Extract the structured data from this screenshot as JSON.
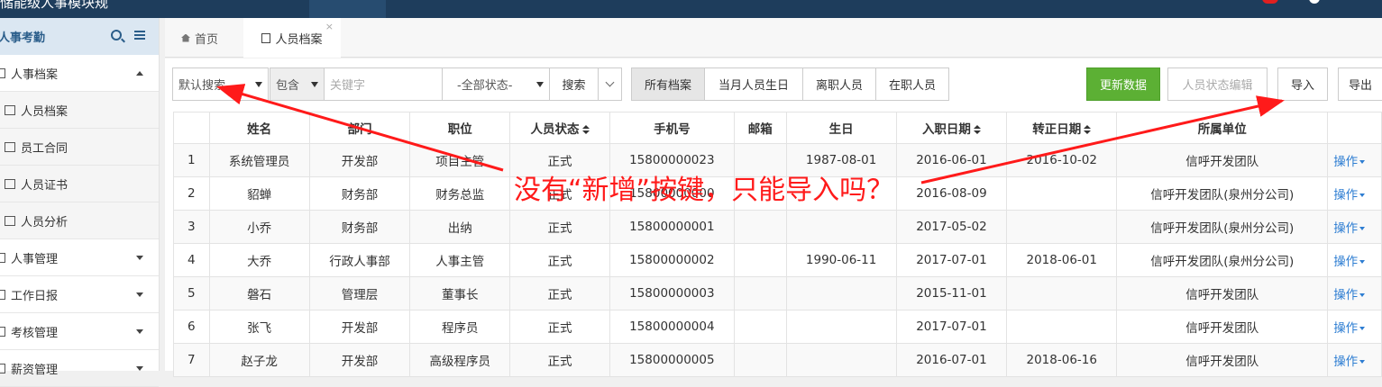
{
  "topbar": {
    "title": "储能级人事模块规",
    "tab_label": ""
  },
  "sidebar": {
    "header": "人事考勤",
    "items": [
      {
        "label": "人事档案",
        "level": "group",
        "expanded": true
      },
      {
        "label": "人员档案",
        "level": "sub"
      },
      {
        "label": "员工合同",
        "level": "sub"
      },
      {
        "label": "人员证书",
        "level": "sub"
      },
      {
        "label": "人员分析",
        "level": "sub"
      },
      {
        "label": "人事管理",
        "level": "group",
        "expanded": false
      },
      {
        "label": "工作日报",
        "level": "group",
        "expanded": false
      },
      {
        "label": "考核管理",
        "level": "group",
        "expanded": false
      },
      {
        "label": "薪资管理",
        "level": "group",
        "expanded": false
      }
    ]
  },
  "tabs": {
    "home": "首页",
    "active": "人员档案",
    "close": "×"
  },
  "toolbar": {
    "search_mode": "默认搜索",
    "match_mode": "包含",
    "keyword_placeholder": "关键字",
    "status_filter": "-全部状态-",
    "search_button": "搜索",
    "segments": [
      "所有档案",
      "当月人员生日",
      "离职人员",
      "在职人员"
    ],
    "refresh_button": "更新数据",
    "status_edit_button": "人员状态编辑",
    "import_button": "导入",
    "export_button": "导出"
  },
  "table": {
    "columns": [
      "",
      "姓名",
      "部门",
      "职位",
      "人员状态",
      "手机号",
      "邮箱",
      "生日",
      "入职日期",
      "转正日期",
      "所属单位",
      ""
    ],
    "rows": [
      [
        "1",
        "系统管理员",
        "开发部",
        "项目主管",
        "正式",
        "15800000023",
        "",
        "1987-08-01",
        "2016-06-01",
        "2016-10-02",
        "信呼开发团队",
        "操作"
      ],
      [
        "2",
        "貂蝉",
        "财务部",
        "财务总监",
        "正式",
        "15800000000",
        "",
        "",
        "2016-08-09",
        "",
        "信呼开发团队(泉州分公司)",
        "操作"
      ],
      [
        "3",
        "小乔",
        "财务部",
        "出纳",
        "正式",
        "15800000001",
        "",
        "",
        "2017-05-02",
        "",
        "信呼开发团队(泉州分公司)",
        "操作"
      ],
      [
        "4",
        "大乔",
        "行政人事部",
        "人事主管",
        "正式",
        "15800000002",
        "",
        "1990-06-11",
        "2017-07-01",
        "2018-06-01",
        "信呼开发团队(泉州分公司)",
        "操作"
      ],
      [
        "5",
        "磐石",
        "管理层",
        "董事长",
        "正式",
        "15800000003",
        "",
        "",
        "2015-11-01",
        "",
        "信呼开发团队",
        "操作"
      ],
      [
        "6",
        "张飞",
        "开发部",
        "程序员",
        "正式",
        "15800000004",
        "",
        "",
        "2017-07-01",
        "",
        "信呼开发团队",
        "操作"
      ],
      [
        "7",
        "赵子龙",
        "开发部",
        "高级程序员",
        "正式",
        "15800000005",
        "",
        "",
        "2016-07-01",
        "2018-06-16",
        "信呼开发团队",
        "操作"
      ]
    ]
  },
  "annotation": {
    "text": "没有“新增”按键，只能导入吗？",
    "color": "#ff1a1a"
  },
  "colors": {
    "topbar": "#1e3d5c",
    "accent": "#2d7dd2",
    "green": "#5cb034",
    "annotation": "#ff1a1a"
  }
}
